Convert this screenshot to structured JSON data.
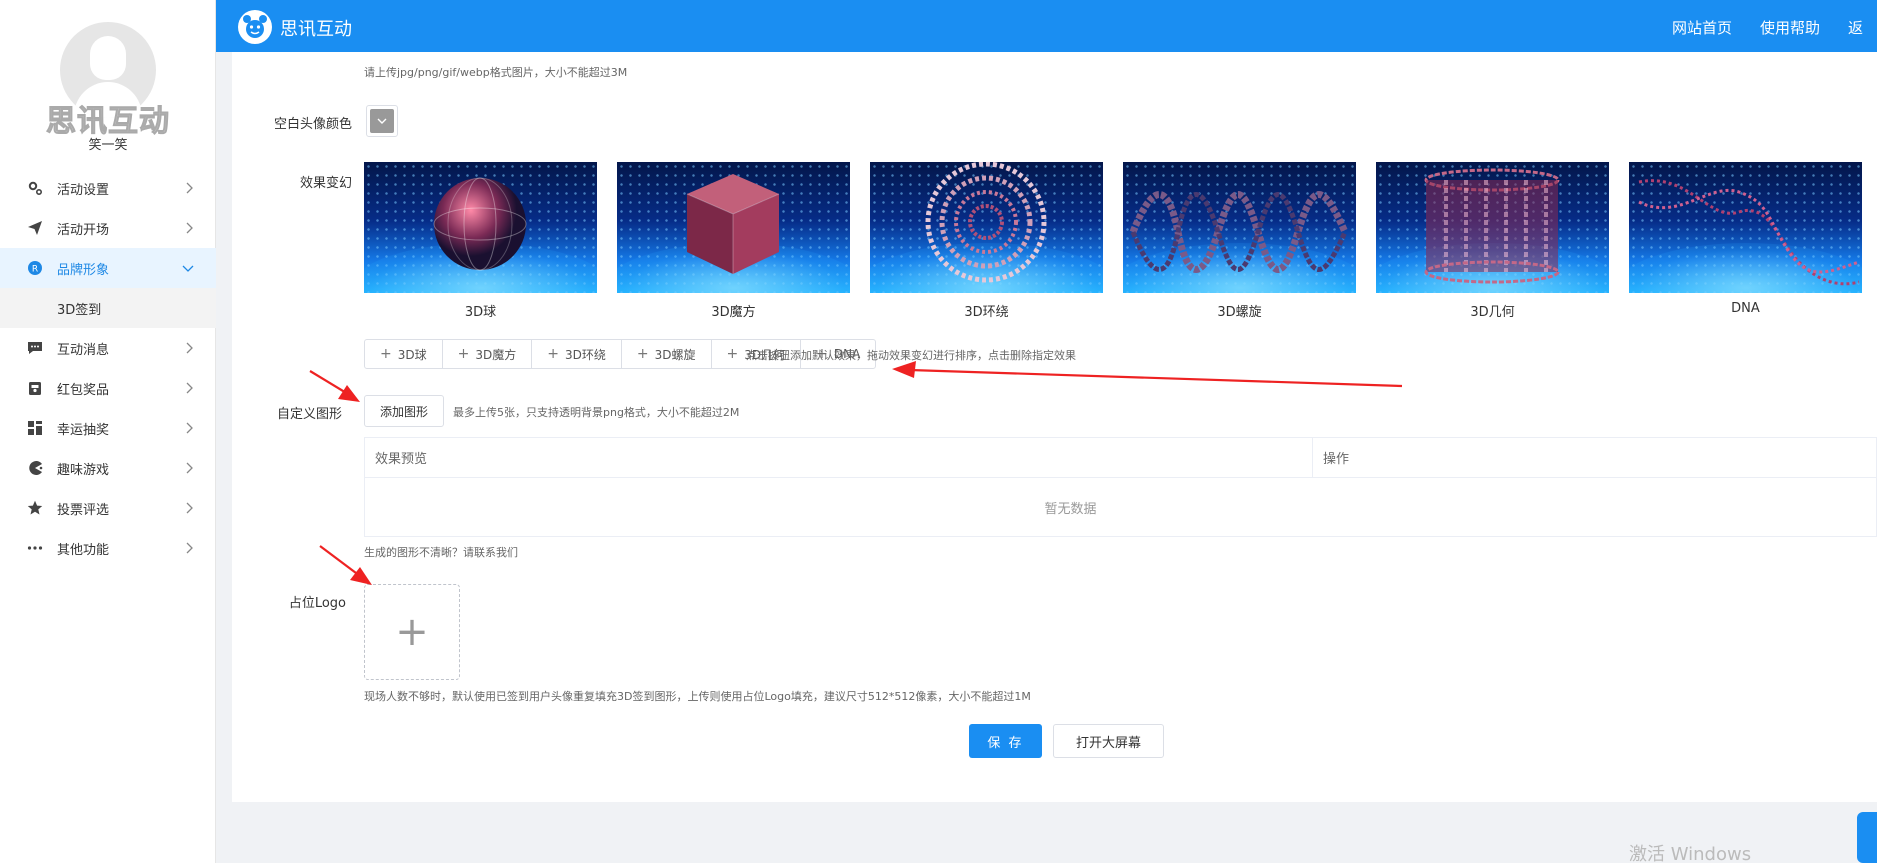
{
  "app": {
    "title": "思讯互动",
    "logo_icon": "bear-logo-icon"
  },
  "header": {
    "links": [
      "网站首页",
      "使用帮助",
      "返"
    ]
  },
  "profile": {
    "brand_watermark": "思讯互动",
    "username": "笑一笑"
  },
  "sidebar": {
    "items": [
      {
        "label": "活动设置",
        "icon": "gear-icon"
      },
      {
        "label": "活动开场",
        "icon": "paper-plane-icon"
      },
      {
        "label": "品牌形象",
        "icon": "registered-icon",
        "active": true,
        "expanded": true
      },
      {
        "label": "互动消息",
        "icon": "chat-icon"
      },
      {
        "label": "红包奖品",
        "icon": "gift-icon"
      },
      {
        "label": "幸运抽奖",
        "icon": "grid-icon"
      },
      {
        "label": "趣味游戏",
        "icon": "pacman-icon"
      },
      {
        "label": "投票评选",
        "icon": "star-icon"
      },
      {
        "label": "其他功能",
        "icon": "more-icon"
      }
    ],
    "submenu": [
      "3D签到"
    ]
  },
  "form": {
    "upload_hint_top": "请上传jpg/png/gif/webp格式图片，大小不能超过3M",
    "blank_avatar_color_label": "空白头像颜色",
    "blank_avatar_color": "#999999",
    "effects_label": "效果变幻",
    "effects": [
      {
        "name": "3D球",
        "shape": "sphere"
      },
      {
        "name": "3D魔方",
        "shape": "cube"
      },
      {
        "name": "3D环绕",
        "shape": "rings"
      },
      {
        "name": "3D螺旋",
        "shape": "helix"
      },
      {
        "name": "3D几何",
        "shape": "cylinder"
      },
      {
        "name": "DNA",
        "shape": "dna"
      }
    ],
    "add_effect_buttons": [
      "3D球",
      "3D魔方",
      "3D环绕",
      "3D螺旋",
      "3D几何",
      "DNA"
    ],
    "add_effect_hint": "点击按钮添加默认效果，拖动效果变幻进行排序，点击删除指定效果",
    "custom_shape_label": "自定义图形",
    "add_shape_button": "添加图形",
    "add_shape_hint": "最多上传5张，只支持透明背景png格式，大小不能超过2M",
    "table": {
      "columns": [
        "效果预览",
        "操作"
      ],
      "empty_text": "暂无数据"
    },
    "unclear_hint": "生成的图形不清晰？请联系我们",
    "placeholder_logo_label": "占位Logo",
    "placeholder_logo_hint": "现场人数不够时，默认使用已签到用户头像重复填充3D签到图形，上传则使用占位Logo填充，建议尺寸512*512像素，大小不能超过1M",
    "save_button": "保 存",
    "open_screen_button": "打开大屏幕"
  },
  "os_watermark": "激活 Windows",
  "colors": {
    "primary": "#1a8ef2",
    "active_bg": "#e8f4ff",
    "annotation_arrow": "#ee2222"
  }
}
